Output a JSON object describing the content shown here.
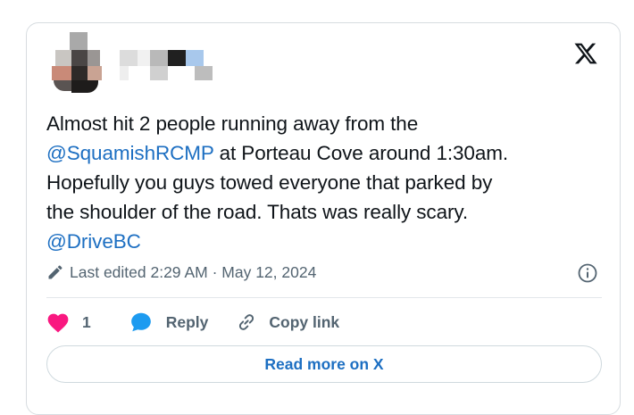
{
  "tweet": {
    "line1": "Almost hit 2 people running away from the",
    "mention1": "@SquamishRCMP",
    "line2_rest": " at Porteau Cove around 1:30am.",
    "line3": "Hopefully you guys towed everyone that parked by",
    "line4": "the shoulder of the road. Thats was really scary.",
    "mention2": "@DriveBC"
  },
  "meta": {
    "edited_label": "Last edited 2:29 AM",
    "separator": " · ",
    "date": "May 12, 2024",
    "edit_icon": "pencil-icon",
    "info_icon": "info-icon"
  },
  "actions": {
    "like_count": "1",
    "reply_label": "Reply",
    "copy_link_label": "Copy link"
  },
  "read_more_label": "Read more on X",
  "colors": {
    "mention": "#1d6fc2",
    "like": "#f91880",
    "text": "#0f1419",
    "secondary": "#536471",
    "reply_bubble": "#1d9bf0"
  },
  "header": {
    "avatar": "blurred-avatar",
    "display_name": "blurred-name",
    "logo_icon": "x-logo-icon"
  }
}
